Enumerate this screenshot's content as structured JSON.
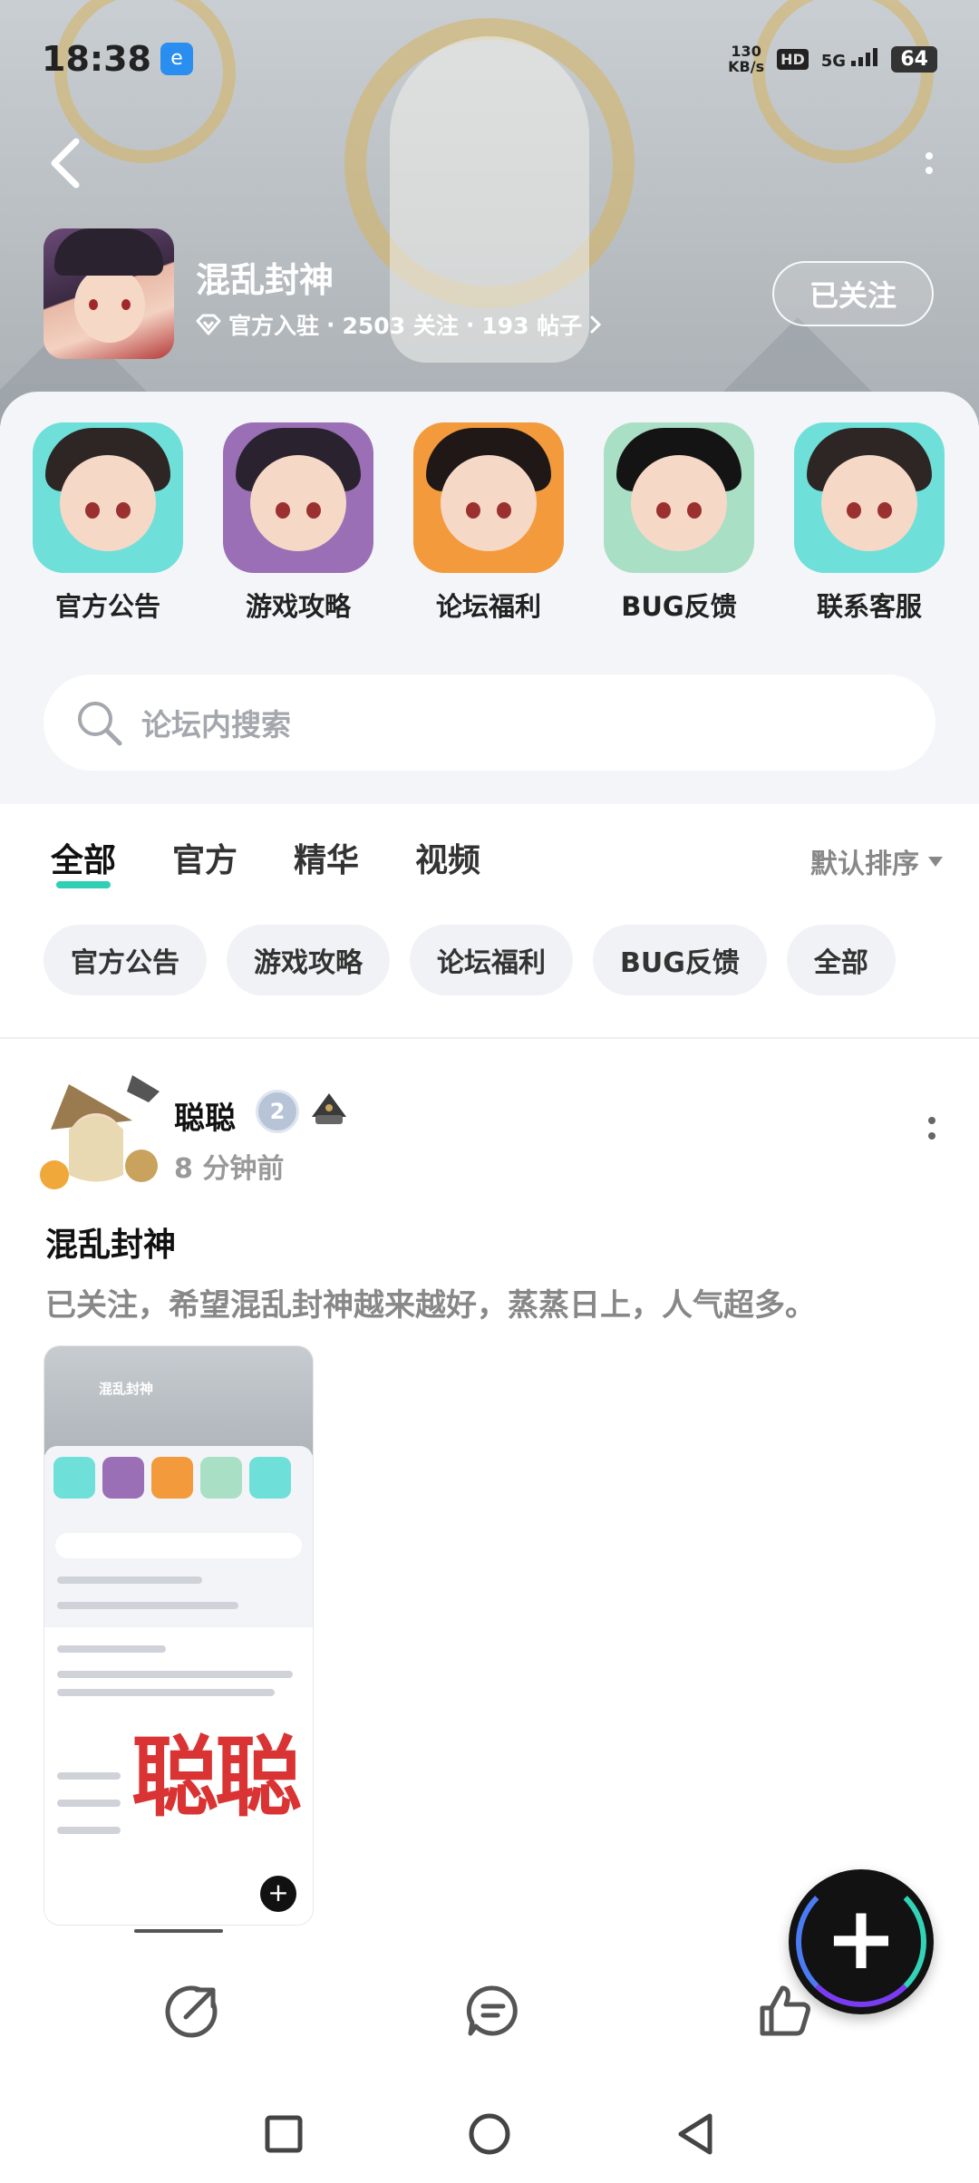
{
  "status_bar": {
    "time": "18:38",
    "app_badge": "e",
    "network_speed_value": "130",
    "network_speed_unit": "KB/s",
    "hd_label": "HD",
    "signal_label": "5G",
    "battery": "64"
  },
  "game": {
    "title": "混乱封神",
    "official_label": "官方入驻",
    "followers": "2503 关注",
    "posts": "193 帖子",
    "separator": "·",
    "follow_button": "已关注"
  },
  "shortcuts": [
    {
      "label": "官方公告",
      "hair": "#2d2624",
      "bg": "#6ee0d9"
    },
    {
      "label": "游戏攻略",
      "hair": "#2b2230",
      "bg": "#9a6fb5"
    },
    {
      "label": "论坛福利",
      "hair": "#1f1817",
      "bg": "#f39a3c"
    },
    {
      "label": "BUG反馈",
      "hair": "#141414",
      "bg": "#a9dfc5"
    },
    {
      "label": "联系客服",
      "hair": "#2d2624",
      "bg": "#6ee0d9"
    }
  ],
  "search": {
    "placeholder": "论坛内搜索"
  },
  "tabs": [
    {
      "label": "全部",
      "active": true
    },
    {
      "label": "官方",
      "active": false
    },
    {
      "label": "精华",
      "active": false
    },
    {
      "label": "视频",
      "active": false
    }
  ],
  "sort_label": "默认排序",
  "chips": [
    "官方公告",
    "游戏攻略",
    "论坛福利",
    "BUG反馈",
    "全部"
  ],
  "post": {
    "author": "聪聪",
    "level": "2",
    "time_ago": "8 分钟前",
    "title": "混乱封神",
    "body": "已关注，希望混乱封神越来越好，蒸蒸日上，人气超多。",
    "image_stamp": "聪聪",
    "image_title": "混乱封神"
  },
  "colors": {
    "accent": "#2fcfb6",
    "stamp_red": "#d93333"
  },
  "icons": {
    "back": "chevron-left-icon",
    "more": "more-vertical-icon",
    "share": "share-icon",
    "comment": "comment-icon",
    "like": "thumbs-up-icon",
    "fab": "plus-icon"
  }
}
